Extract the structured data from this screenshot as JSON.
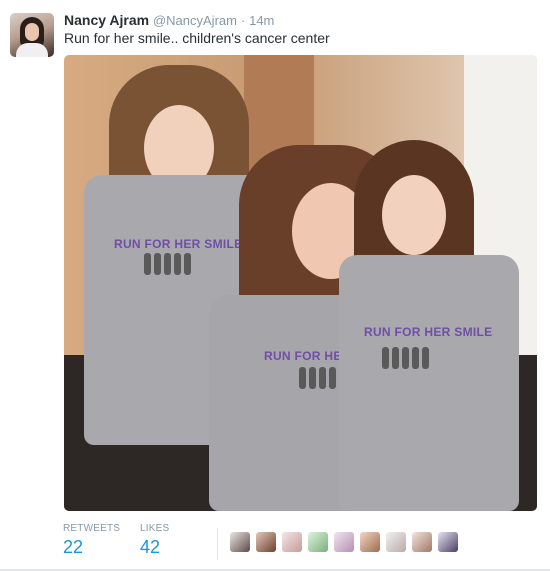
{
  "tweet": {
    "author_name": "Nancy Ajram",
    "author_handle": "@NancyAjram",
    "separator": "·",
    "time": "14m",
    "text": "Run for her smile.. children's cancer center"
  },
  "photo": {
    "shirt_print": "RUN FOR HER SMILE"
  },
  "stats": {
    "retweets_label": "RETWEETS",
    "retweets_value": "22",
    "likes_label": "LIKES",
    "likes_value": "42"
  },
  "likers": [
    {
      "icon": "avatar-icon"
    },
    {
      "icon": "avatar-icon"
    },
    {
      "icon": "avatar-icon"
    },
    {
      "icon": "avatar-icon"
    },
    {
      "icon": "avatar-icon"
    },
    {
      "icon": "avatar-icon"
    },
    {
      "icon": "avatar-icon"
    },
    {
      "icon": "avatar-icon"
    },
    {
      "icon": "avatar-icon"
    }
  ],
  "colors": {
    "link_blue": "#1b95e0",
    "text_dark": "#292f33",
    "muted": "#8899a6"
  }
}
